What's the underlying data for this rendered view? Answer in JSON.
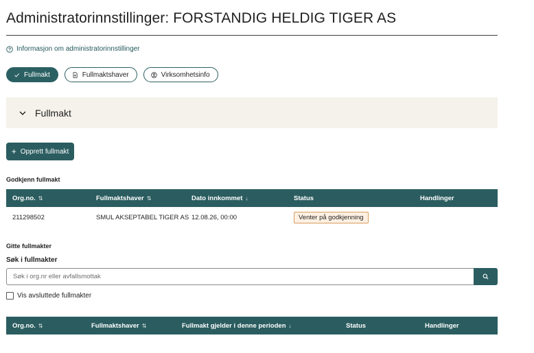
{
  "page": {
    "title": "Administratorinnstillinger: FORSTANDIG HELDIG TIGER AS",
    "info_link": "Informasjon om administratorinnstillinger"
  },
  "chips": [
    {
      "label": "Fullmakt",
      "icon": "check-icon",
      "active": true
    },
    {
      "label": "Fullmaktshaver",
      "icon": "document-icon",
      "active": false
    },
    {
      "label": "Virksomhetsinfo",
      "icon": "user-circle-icon",
      "active": false
    }
  ],
  "accordion": {
    "label": "Fullmakt",
    "icon": "chevron-down-icon"
  },
  "create_button": {
    "label": "Opprett fullmakt"
  },
  "approve_section": {
    "label": "Godkjenn fullmakt",
    "columns": [
      "Org.no.",
      "Fullmaktshaver",
      "Dato innkommet",
      "Status",
      "Handlinger"
    ],
    "rows": [
      {
        "org_no": "211298502",
        "holder": "SMUL AKSEPTABEL TIGER AS",
        "date": "12.08.26, 00:00",
        "status": "Venter på godkjenning",
        "actions": ""
      }
    ]
  },
  "given_section": {
    "label": "Gitte fullmakter",
    "search_label": "Søk i fullmakter",
    "search_placeholder": "Søk i org.nr eller avfallsmottak",
    "search_value": "",
    "checkbox_label": "Vis avsluttede fullmakter",
    "checkbox_checked": false,
    "columns": [
      "Org.no.",
      "Fullmaktshaver",
      "Fullmakt gjelder i denne perioden",
      "Status",
      "Handlinger"
    ]
  },
  "colors": {
    "primary": "#2b5d60",
    "accordion_bg": "#f4f2ea",
    "badge_bg": "#fdf0e2",
    "badge_border": "#d89b5c"
  }
}
